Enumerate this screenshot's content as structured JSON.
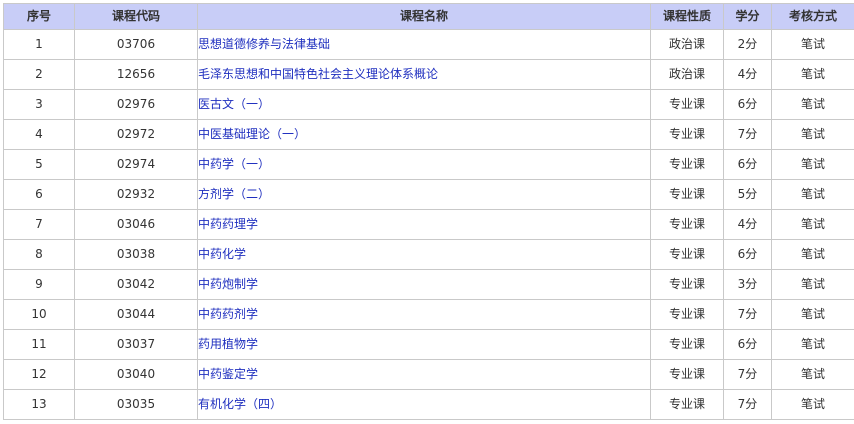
{
  "table": {
    "headers": [
      "序号",
      "课程代码",
      "课程名称",
      "课程性质",
      "学分",
      "考核方式"
    ],
    "rows": [
      [
        "1",
        "03706",
        "思想道德修养与法律基础",
        "政治课",
        "2分",
        "笔试"
      ],
      [
        "2",
        "12656",
        "毛泽东思想和中国特色社会主义理论体系概论",
        "政治课",
        "4分",
        "笔试"
      ],
      [
        "3",
        "02976",
        "医古文（一）",
        "专业课",
        "6分",
        "笔试"
      ],
      [
        "4",
        "02972",
        "中医基础理论（一）",
        "专业课",
        "7分",
        "笔试"
      ],
      [
        "5",
        "02974",
        "中药学（一）",
        "专业课",
        "6分",
        "笔试"
      ],
      [
        "6",
        "02932",
        "方剂学（二）",
        "专业课",
        "5分",
        "笔试"
      ],
      [
        "7",
        "03046",
        "中药药理学",
        "专业课",
        "4分",
        "笔试"
      ],
      [
        "8",
        "03038",
        "中药化学",
        "专业课",
        "6分",
        "笔试"
      ],
      [
        "9",
        "03042",
        "中药炮制学",
        "专业课",
        "3分",
        "笔试"
      ],
      [
        "10",
        "03044",
        "中药药剂学",
        "专业课",
        "7分",
        "笔试"
      ],
      [
        "11",
        "03037",
        "药用植物学",
        "专业课",
        "6分",
        "笔试"
      ],
      [
        "12",
        "03040",
        "中药鉴定学",
        "专业课",
        "7分",
        "笔试"
      ],
      [
        "13",
        "03035",
        "有机化学（四）",
        "专业课",
        "7分",
        "笔试"
      ]
    ]
  },
  "colors": {
    "header_bg": "#c8cdf7",
    "link": "#1f2fbf",
    "border": "#c9c9c9",
    "text": "#333333"
  }
}
